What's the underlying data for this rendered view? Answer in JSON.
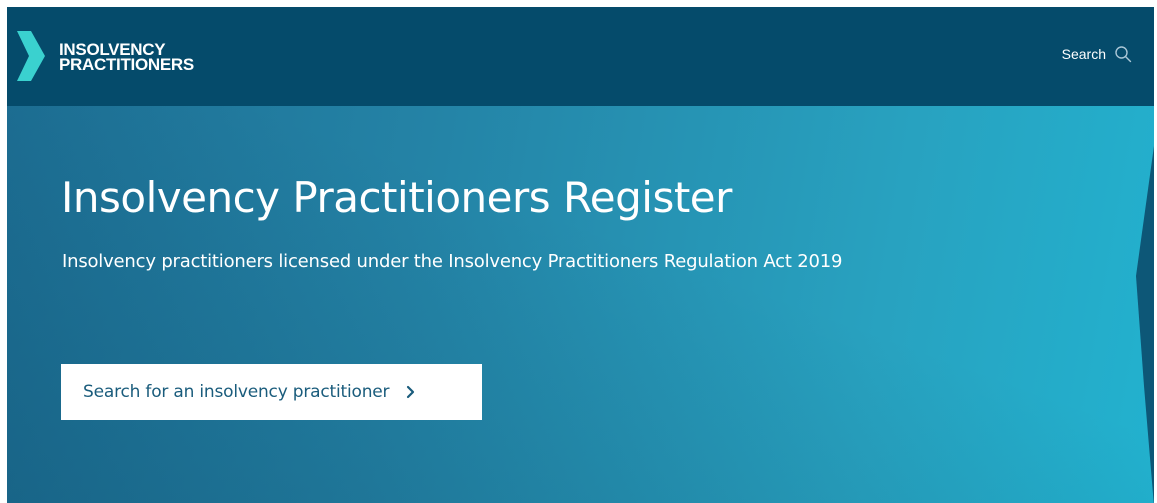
{
  "header": {
    "logo": {
      "line1": "INSOLVENCY",
      "line2": "PRACTITIONERS",
      "icon": "chevron-logo-icon"
    },
    "search": {
      "label": "Search",
      "icon": "search-icon"
    }
  },
  "hero": {
    "title": "Insolvency Practitioners Register",
    "subtitle": "Insolvency practitioners licensed under the Insolvency Practitioners Regulation Act 2019",
    "cta": {
      "label": "Search for an insolvency practitioner",
      "icon": "chevron-right-icon"
    }
  },
  "colors": {
    "header_bg": "#054b6b",
    "hero_start": "#1d6f94",
    "hero_end": "#22b2cf",
    "logo_accent": "#3ad1cf",
    "button_text": "#1a5c7c"
  }
}
